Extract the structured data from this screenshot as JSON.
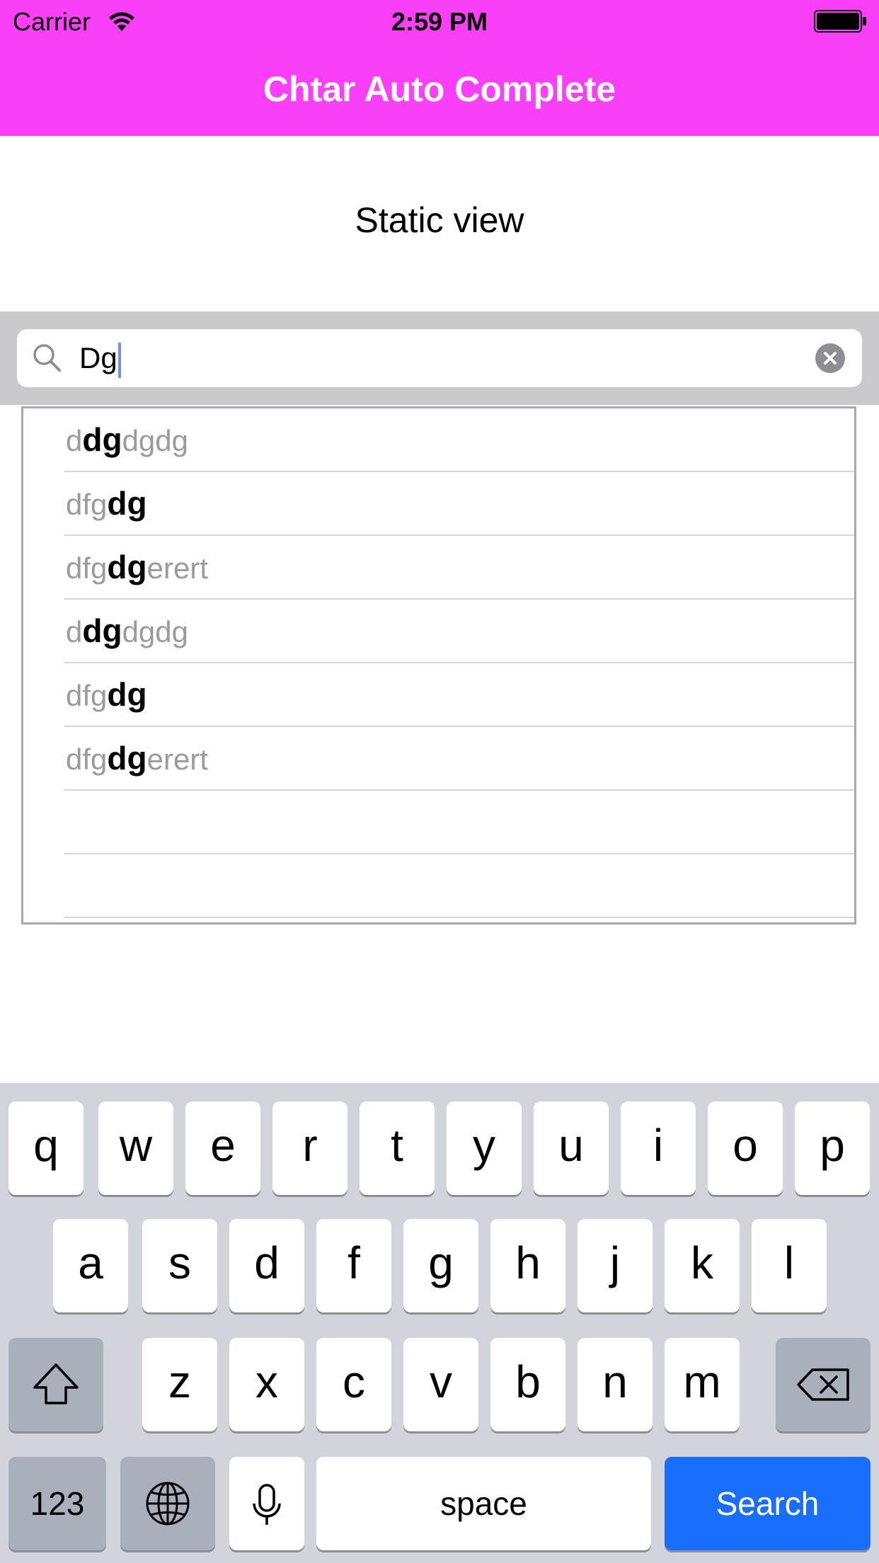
{
  "status_bar": {
    "carrier": "Carrier",
    "time": "2:59 PM"
  },
  "nav": {
    "title": "Chtar Auto Complete"
  },
  "static_view": {
    "label": "Static view"
  },
  "search": {
    "value": "Dg"
  },
  "suggestions": [
    {
      "prefix": "d",
      "match": "dg",
      "suffix": "dgdg"
    },
    {
      "prefix": "dfg",
      "match": "dg",
      "suffix": ""
    },
    {
      "prefix": "dfg",
      "match": "dg",
      "suffix": "erert"
    },
    {
      "prefix": "d",
      "match": "dg",
      "suffix": "dgdg"
    },
    {
      "prefix": "dfg",
      "match": "dg",
      "suffix": ""
    },
    {
      "prefix": "dfg",
      "match": "dg",
      "suffix": "erert"
    }
  ],
  "keyboard": {
    "row1": [
      "q",
      "w",
      "e",
      "r",
      "t",
      "y",
      "u",
      "i",
      "o",
      "p"
    ],
    "row2": [
      "a",
      "s",
      "d",
      "f",
      "g",
      "h",
      "j",
      "k",
      "l"
    ],
    "row3": [
      "z",
      "x",
      "c",
      "v",
      "b",
      "n",
      "m"
    ],
    "numbers_label": "123",
    "space_label": "space",
    "search_label": "Search"
  },
  "colors": {
    "nav_background": "#fb3ff9",
    "search_key": "#1a6efe",
    "caret": "#6f8ff4"
  }
}
